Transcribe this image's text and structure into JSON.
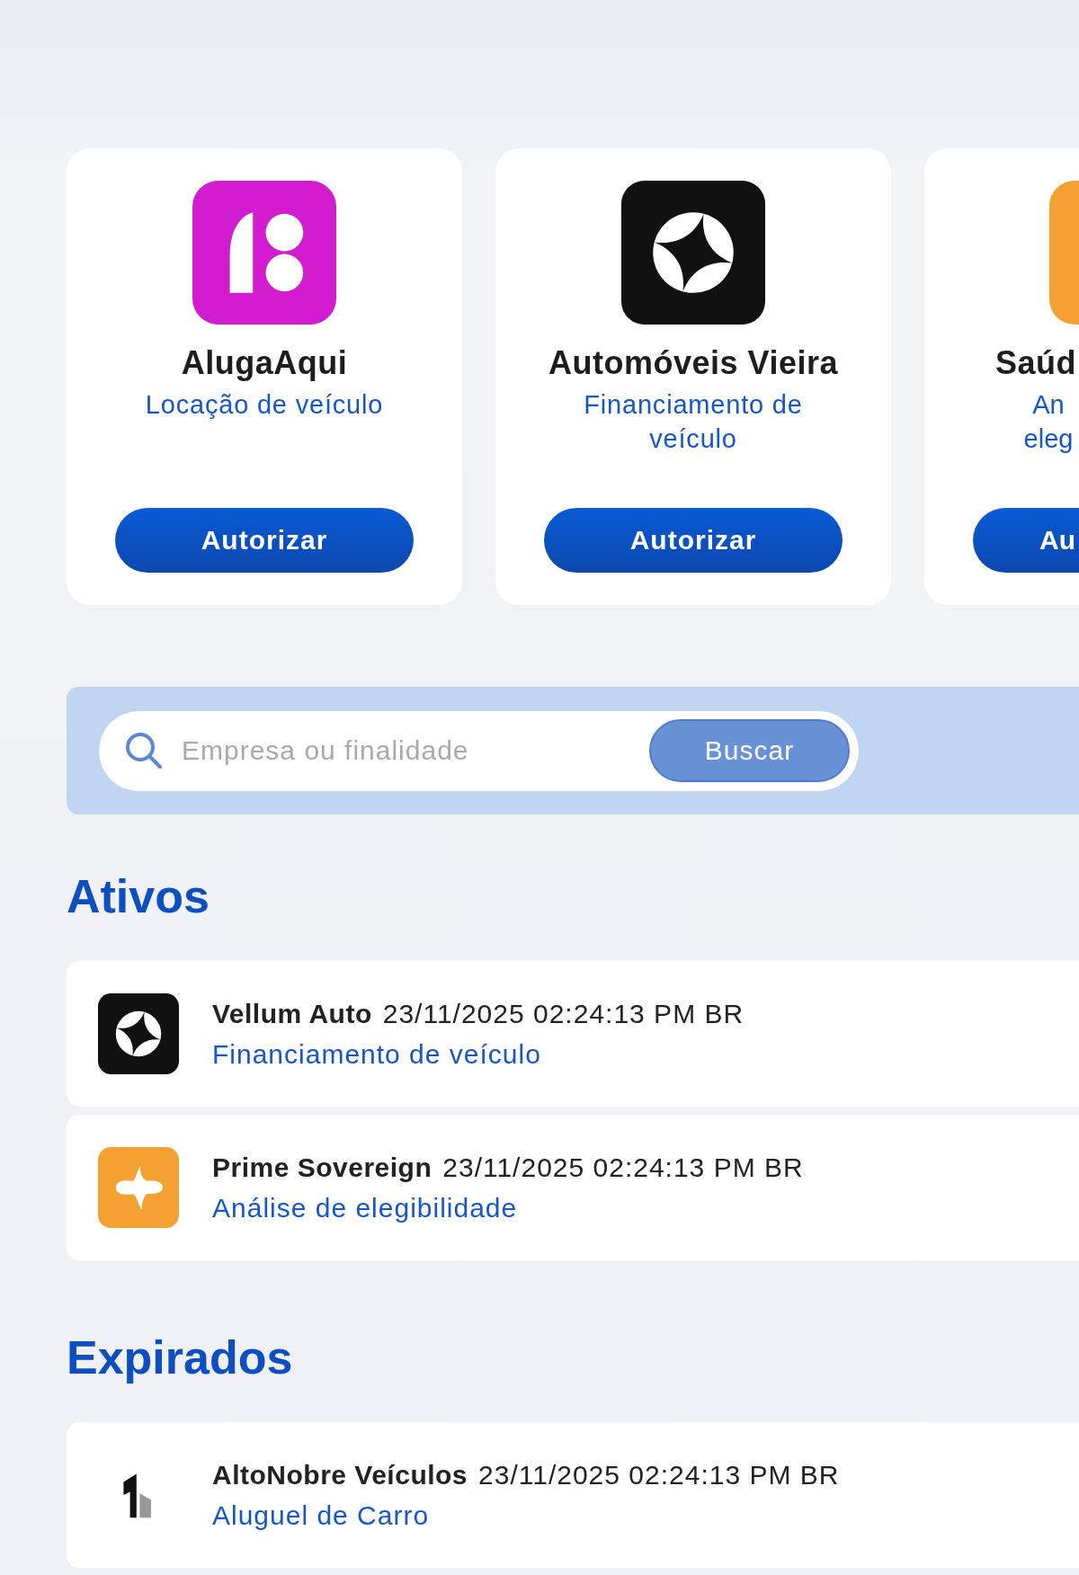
{
  "cards": [
    {
      "name": "AlugaAqui",
      "purpose": "Locação de veículo",
      "button": "Autorizar",
      "kind": "aluga",
      "cut": false
    },
    {
      "name": "Automóveis Vieira",
      "purpose": "Financiamento de veículo",
      "button": "Autorizar",
      "kind": "star",
      "cut": false
    },
    {
      "name": "Saúd",
      "purpose": "An\neleg",
      "button": "Au",
      "kind": "spark",
      "cut": true
    }
  ],
  "search": {
    "placeholder": "Empresa ou finalidade",
    "button": "Buscar"
  },
  "sections": [
    {
      "title": "Ativos",
      "items": [
        {
          "company": "Vellum Auto",
          "date": "23/11/2025 02:24:13 PM BR",
          "purpose": "Financiamento de veículo",
          "kind": "star"
        },
        {
          "company": "Prime Sovereign",
          "date": "23/11/2025 02:24:13 PM BR",
          "purpose": "Análise de elegibilidade",
          "kind": "spark"
        }
      ]
    },
    {
      "title": "Expirados",
      "items": [
        {
          "company": "AltoNobre Veículos",
          "date": "23/11/2025 02:24:13 PM BR",
          "purpose": "Aluguel de Carro",
          "kind": "building"
        }
      ]
    }
  ]
}
